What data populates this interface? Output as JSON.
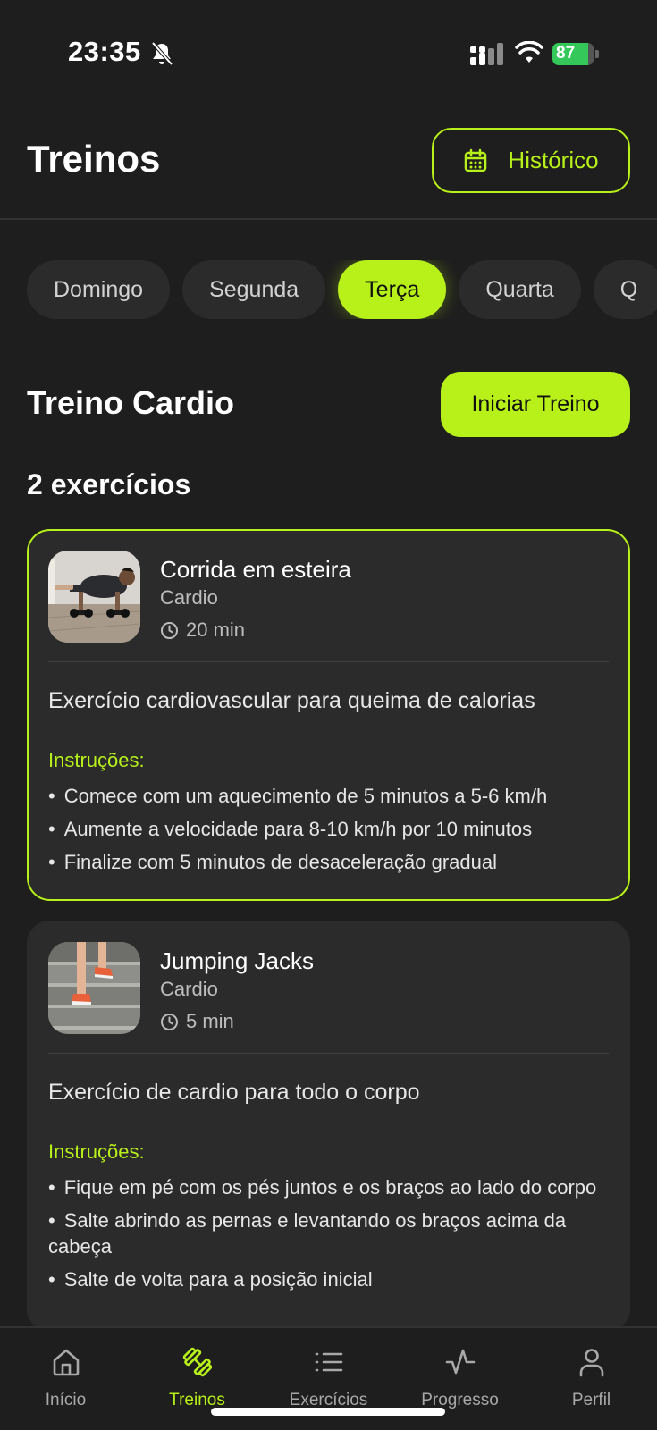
{
  "status_bar": {
    "time": "23:35",
    "battery": "87",
    "battery_level": 0.87,
    "icons": [
      "bell-slash-icon",
      "signal-icon",
      "wifi-icon",
      "battery-charging-icon"
    ]
  },
  "header": {
    "title": "Treinos",
    "history_button": "Histórico",
    "history_icon": "calendar-icon"
  },
  "days": [
    "Domingo",
    "Segunda",
    "Terça",
    "Quarta",
    "Q"
  ],
  "active_day": "Terça",
  "workout": {
    "title": "Treino Cardio",
    "start_button": "Iniciar Treino",
    "count_label": "2 exercícios"
  },
  "exercises": [
    {
      "name": "Corrida em esteira",
      "category": "Cardio",
      "duration": "20 min",
      "description": "Exercício cardiovascular para queima de calorias",
      "instructions_title": "Instruções:",
      "instructions": [
        "Comece com um aquecimento de 5 minutos a 5-6 km/h",
        "Aumente a velocidade para 8-10 km/h por 10 minutos",
        "Finalize com 5 minutos de desaceleração gradual"
      ]
    },
    {
      "name": "Jumping Jacks",
      "category": "Cardio",
      "duration": "5 min",
      "description": "Exercício de cardio para todo o corpo",
      "instructions_title": "Instruções:",
      "instructions": [
        "Fique em pé com os pés juntos e os braços ao lado do corpo",
        "Salte abrindo as pernas e levantando os braços acima da cabeça",
        "Salte de volta para a posição inicial"
      ]
    }
  ],
  "nav": [
    {
      "label": "Início",
      "icon": "home-icon"
    },
    {
      "label": "Treinos",
      "icon": "dumbbell-icon"
    },
    {
      "label": "Exercícios",
      "icon": "list-icon"
    },
    {
      "label": "Progresso",
      "icon": "activity-icon"
    },
    {
      "label": "Perfil",
      "icon": "user-icon"
    }
  ],
  "active_nav": "Treinos",
  "colors": {
    "accent": "#b8f01a",
    "background": "#1e1e1e",
    "card": "#2b2b2b",
    "battery": "#34c759"
  }
}
